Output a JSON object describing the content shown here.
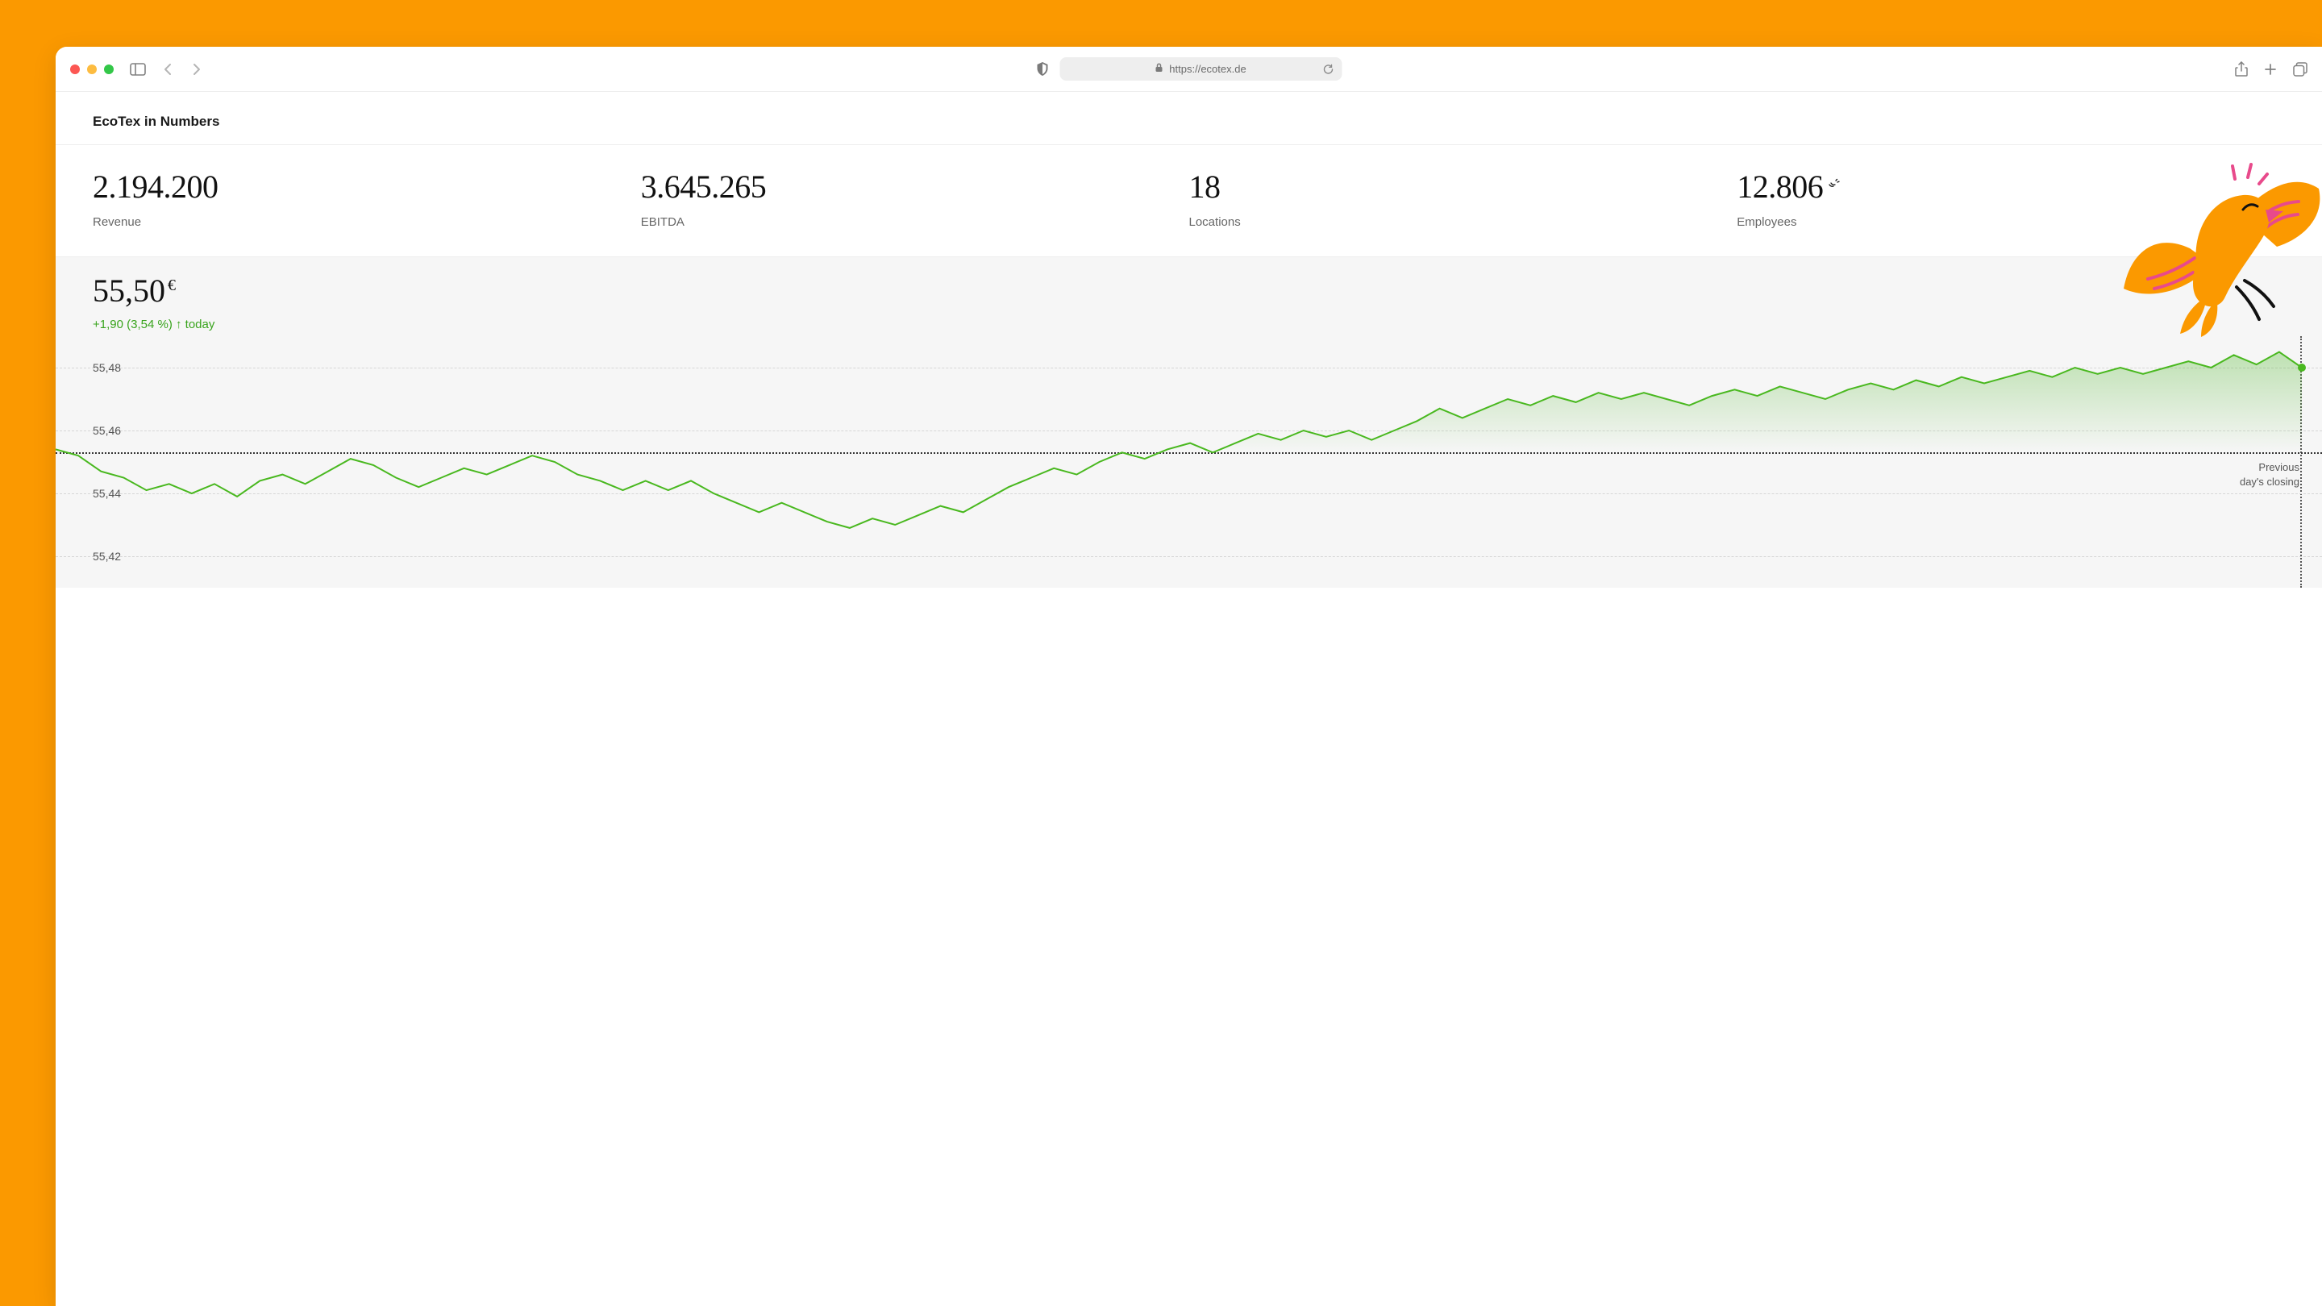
{
  "browser": {
    "url": "https://ecotex.de"
  },
  "header": {
    "title": "EcoTex in Numbers"
  },
  "kpis": [
    {
      "value": "2.194.200",
      "label": "Revenue"
    },
    {
      "value": "3.645.265",
      "label": "EBITDA"
    },
    {
      "value": "18",
      "label": "Locations"
    },
    {
      "value": "12.806",
      "label": "Employees"
    }
  ],
  "stock": {
    "price": "55,50",
    "currency": "€",
    "delta": "+1,90 (3,54 %) ↑ today",
    "prev_label": "Previous\nday's closing"
  },
  "chart_data": {
    "type": "line",
    "ylabel": "",
    "xlabel": "",
    "ylim": [
      55.41,
      55.49
    ],
    "yticks": [
      "55,48",
      "55,46",
      "55,44",
      "55,42"
    ],
    "previous_close": 55.453,
    "series": [
      {
        "name": "price",
        "values": [
          55.454,
          55.452,
          55.447,
          55.445,
          55.441,
          55.443,
          55.44,
          55.443,
          55.439,
          55.444,
          55.446,
          55.443,
          55.447,
          55.451,
          55.449,
          55.445,
          55.442,
          55.445,
          55.448,
          55.446,
          55.449,
          55.452,
          55.45,
          55.446,
          55.444,
          55.441,
          55.444,
          55.441,
          55.444,
          55.44,
          55.437,
          55.434,
          55.437,
          55.434,
          55.431,
          55.429,
          55.432,
          55.43,
          55.433,
          55.436,
          55.434,
          55.438,
          55.442,
          55.445,
          55.448,
          55.446,
          55.45,
          55.453,
          55.451,
          55.454,
          55.456,
          55.453,
          55.456,
          55.459,
          55.457,
          55.46,
          55.458,
          55.46,
          55.457,
          55.46,
          55.463,
          55.467,
          55.464,
          55.467,
          55.47,
          55.468,
          55.471,
          55.469,
          55.472,
          55.47,
          55.472,
          55.47,
          55.468,
          55.471,
          55.473,
          55.471,
          55.474,
          55.472,
          55.47,
          55.473,
          55.475,
          55.473,
          55.476,
          55.474,
          55.477,
          55.475,
          55.477,
          55.479,
          55.477,
          55.48,
          55.478,
          55.48,
          55.478,
          55.48,
          55.482,
          55.48,
          55.484,
          55.481,
          55.485,
          55.48
        ]
      }
    ]
  }
}
